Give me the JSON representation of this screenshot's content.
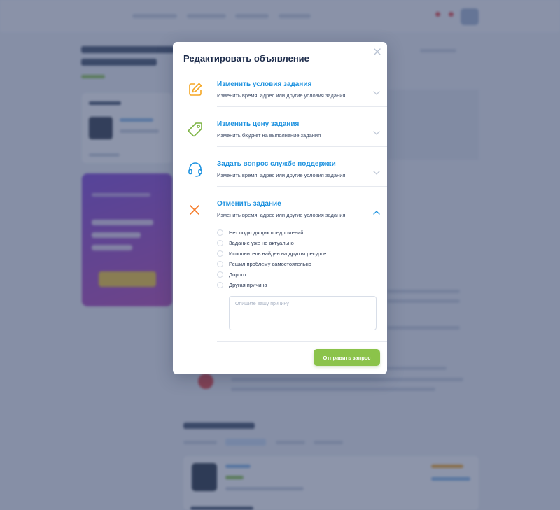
{
  "modal": {
    "title": "Редактировать объявление",
    "options": [
      {
        "title": "Изменить условия задания",
        "desc": "Изменить время, адрес или другие условия задания",
        "icon": "edit-icon",
        "color": "#f5a623",
        "expanded": false
      },
      {
        "title": "Изменить цену задания",
        "desc": "Изменить бюджет на выполнение задания",
        "icon": "price-tag-icon",
        "color": "#7cb342",
        "expanded": false
      },
      {
        "title": "Задать вопрос службе поддержки",
        "desc": "Изменить время, адрес или другие условия задания",
        "icon": "headset-icon",
        "color": "#1f93e0",
        "expanded": false
      },
      {
        "title": "Отменить задание",
        "desc": "Изменить время, адрес или другие условия задания",
        "icon": "cancel-x-icon",
        "color": "#f57c2b",
        "expanded": true
      }
    ],
    "cancel_reasons": [
      "Нет подходящих предложений",
      "Задание уже не актуально",
      "Исполнитель найден на другом ресурсе",
      "Решил проблему самостоятельно",
      "Дорого",
      "Другая причина"
    ],
    "reason_placeholder": "Опишите вашу причину",
    "submit_label": "Отправить запрос"
  },
  "colors": {
    "accent": "#1f93e0",
    "submit": "#8bc34a",
    "overlay": "#3a486c"
  }
}
